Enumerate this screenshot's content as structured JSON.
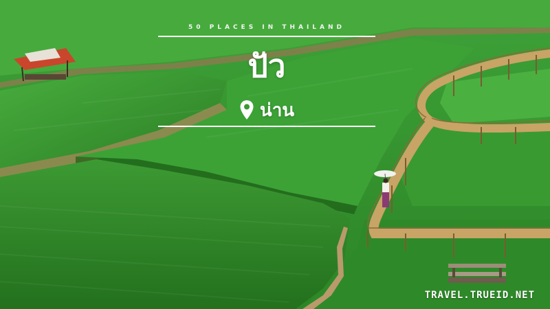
{
  "overlay": {
    "kicker": "50 PLACES IN THAILAND",
    "place_name": "ปัว",
    "province": "น่าน",
    "pin_icon": "location-pin-icon"
  },
  "watermark": "TRAVEL.TRUEID.NET",
  "colors": {
    "field_light": "#3fa43a",
    "field_dark": "#1f6a1a",
    "path": "#a8875a",
    "bridge": "#c9a66a",
    "text": "#ffffff"
  }
}
